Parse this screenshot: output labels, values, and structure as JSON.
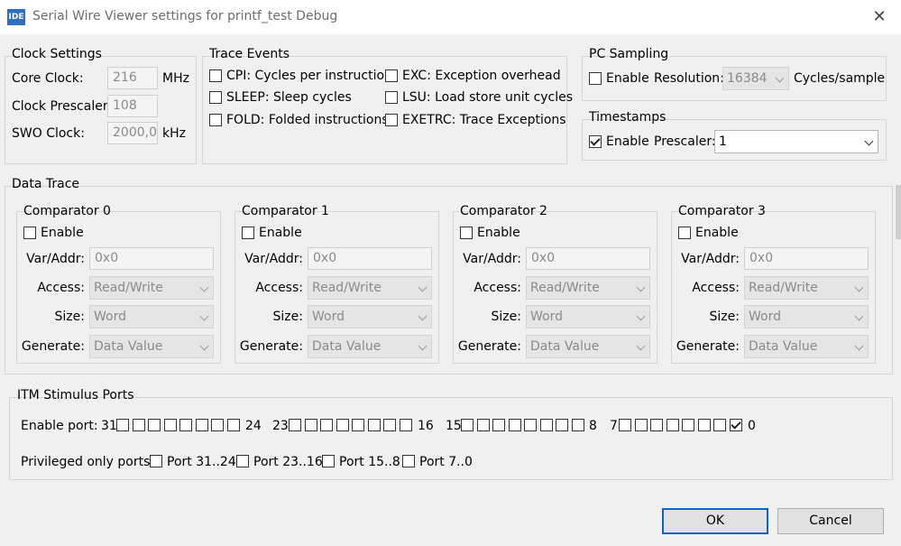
{
  "window": {
    "title": "Serial Wire Viewer settings for printf_test Debug",
    "icon": "IDE",
    "close": "✕"
  },
  "clock": {
    "legend": "Clock Settings",
    "core_label": "Core Clock:",
    "core_value": "216",
    "core_unit": "MHz",
    "prescaler_label": "Clock Prescaler:",
    "prescaler_value": "108",
    "swo_label": "SWO Clock:",
    "swo_value": "2000,0",
    "swo_unit": "kHz"
  },
  "trace_events": {
    "legend": "Trace Events",
    "cpi": "CPI: Cycles per instruction",
    "exc": "EXC: Exception overhead",
    "sleep": "SLEEP: Sleep cycles",
    "lsu": "LSU: Load store unit cycles",
    "fold": "FOLD: Folded instructions",
    "exetrc": "EXETRC: Trace Exceptions"
  },
  "pc_sampling": {
    "legend": "PC Sampling",
    "enable": "Enable",
    "resolution_label": "Resolution:",
    "resolution_value": "16384",
    "unit": "Cycles/sample"
  },
  "timestamps": {
    "legend": "Timestamps",
    "enable": "Enable",
    "prescaler_label": "Prescaler:",
    "prescaler_value": "1"
  },
  "data_trace": {
    "legend": "Data Trace",
    "comparators": [
      {
        "title": "Comparator 0",
        "enable": "Enable",
        "var_label": "Var/Addr:",
        "var_value": "0x0",
        "access_label": "Access:",
        "access_value": "Read/Write",
        "size_label": "Size:",
        "size_value": "Word",
        "generate_label": "Generate:",
        "generate_value": "Data Value"
      },
      {
        "title": "Comparator 1",
        "enable": "Enable",
        "var_label": "Var/Addr:",
        "var_value": "0x0",
        "access_label": "Access:",
        "access_value": "Read/Write",
        "size_label": "Size:",
        "size_value": "Word",
        "generate_label": "Generate:",
        "generate_value": "Data Value"
      },
      {
        "title": "Comparator 2",
        "enable": "Enable",
        "var_label": "Var/Addr:",
        "var_value": "0x0",
        "access_label": "Access:",
        "access_value": "Read/Write",
        "size_label": "Size:",
        "size_value": "Word",
        "generate_label": "Generate:",
        "generate_value": "Data Value"
      },
      {
        "title": "Comparator 3",
        "enable": "Enable",
        "var_label": "Var/Addr:",
        "var_value": "0x0",
        "access_label": "Access:",
        "access_value": "Read/Write",
        "size_label": "Size:",
        "size_value": "Word",
        "generate_label": "Generate:",
        "generate_value": "Data Value"
      }
    ]
  },
  "itm": {
    "legend": "ITM Stimulus Ports",
    "enable_label": "Enable port:",
    "groups": [
      {
        "start": "31",
        "end": "24"
      },
      {
        "start": "23",
        "end": "16"
      },
      {
        "start": "15",
        "end": "8"
      },
      {
        "start": "7",
        "end": "0"
      }
    ],
    "privileged_label": "Privileged only ports:",
    "priv_ports": [
      "Port 31..24",
      "Port 23..16",
      "Port 15..8",
      "Port 7..0"
    ]
  },
  "buttons": {
    "ok": "OK",
    "cancel": "Cancel"
  }
}
